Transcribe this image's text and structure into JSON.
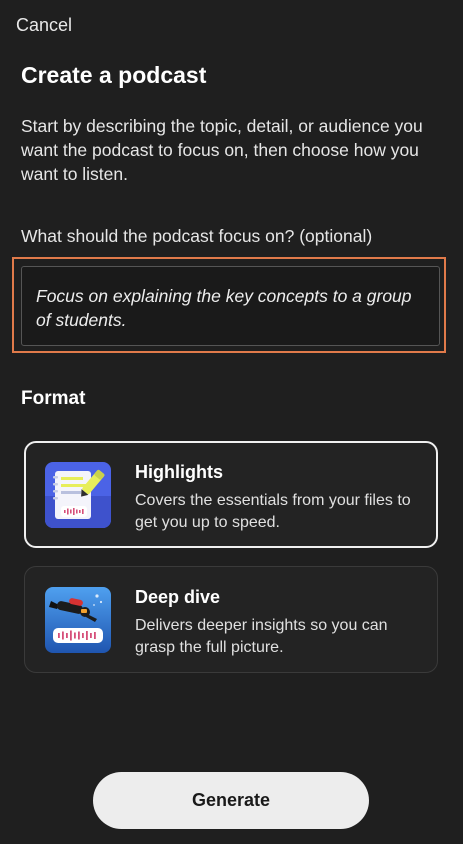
{
  "header": {
    "cancel_label": "Cancel",
    "title": "Create a podcast",
    "intro": "Start by describing the topic, detail, or audience you want the podcast to focus on, then choose how you want to listen."
  },
  "focus": {
    "label": "What should the podcast focus on? (optional)",
    "value": "Focus on explaining the key concepts to a group of students."
  },
  "format": {
    "heading": "Format",
    "options": [
      {
        "title": "Highlights",
        "description": "Covers the essentials from your files to get you up to speed.",
        "icon": "highlights-notepad-icon",
        "selected": true
      },
      {
        "title": "Deep dive",
        "description": "Delivers deeper insights so you can grasp the full picture.",
        "icon": "deep-dive-diver-icon",
        "selected": false
      }
    ]
  },
  "actions": {
    "generate_label": "Generate"
  },
  "colors": {
    "background": "#1f1f1f",
    "focus_highlight": "#e07a4a",
    "button_bg": "#ededed",
    "selected_border": "#f0f0f0"
  }
}
